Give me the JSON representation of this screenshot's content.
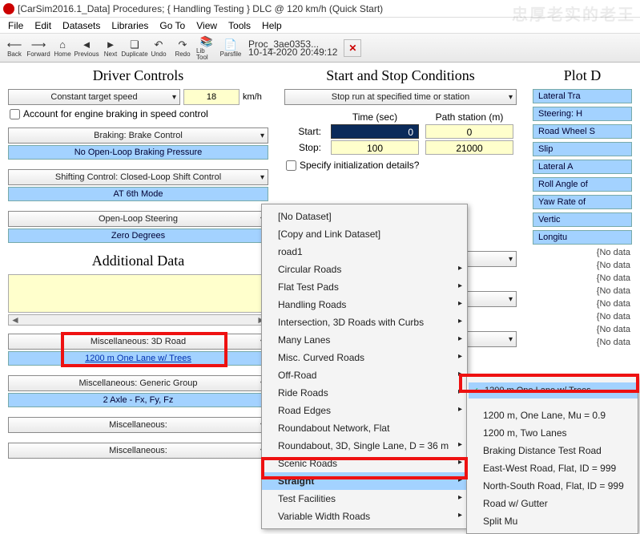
{
  "window": {
    "title": "[CarSim2016.1_Data] Procedures; { Handling Testing } DLC @ 120 km/h (Quick Start)"
  },
  "menu": [
    "File",
    "Edit",
    "Datasets",
    "Libraries",
    "Go To",
    "View",
    "Tools",
    "Help"
  ],
  "toolbar": {
    "back": "Back",
    "forward": "Forward",
    "home": "Home",
    "previous": "Previous",
    "next": "Next",
    "duplicate": "Duplicate",
    "undo": "Undo",
    "redo": "Redo",
    "libtool": "Lib Tool",
    "parsfile": "Parsfile",
    "proc_name": "Proc_3ae0353...",
    "proc_date": "10-14-2020 20:49:12",
    "delete": "Delete"
  },
  "driver": {
    "heading": "Driver Controls",
    "mode": "Constant target speed",
    "speed": "18",
    "unit": "km/h",
    "engine_braking": "Account for engine braking in speed control",
    "braking_label": "Braking: Brake Control",
    "braking_value": "No Open-Loop Braking Pressure",
    "shift_label": "Shifting Control: Closed-Loop Shift Control",
    "shift_value": "AT 6th Mode",
    "steer_label": "Open-Loop Steering",
    "steer_value": "Zero Degrees"
  },
  "additional": {
    "heading": "Additional Data",
    "misc_road_label": "Miscellaneous: 3D Road",
    "misc_road_value": "1200 m One Lane w/ Trees",
    "misc_group_label": "Miscellaneous: Generic Group",
    "misc_group_value": "2 Axle - Fx, Fy, Fz",
    "misc_blank": "Miscellaneous:"
  },
  "startstop": {
    "heading": "Start and Stop Conditions",
    "mode": "Stop run at specified time or station",
    "time_hdr": "Time (sec)",
    "path_hdr": "Path station (m)",
    "start_lab": "Start:",
    "stop_lab": "Stop:",
    "start_time": "0",
    "start_path": "0",
    "stop_time": "100",
    "stop_path": "21000",
    "init_details": "Specify initialization details?"
  },
  "plot": {
    "heading": "Plot D",
    "rows": [
      "Lateral Tra",
      "Steering: H",
      "Road Wheel S",
      "Slip",
      "Lateral A",
      "Roll Angle of",
      "Yaw Rate of",
      "Vertic",
      "Longitu"
    ],
    "nodata": "{No data"
  },
  "ctx_menu": {
    "items": [
      {
        "label": "[No Dataset]",
        "sub": false
      },
      {
        "label": "[Copy and Link Dataset]",
        "sub": false
      },
      {
        "label": "road1",
        "sub": false
      },
      {
        "label": "Circular Roads",
        "sub": true
      },
      {
        "label": "Flat Test Pads",
        "sub": true
      },
      {
        "label": "Handling Roads",
        "sub": true
      },
      {
        "label": "Intersection, 3D Roads with Curbs",
        "sub": true
      },
      {
        "label": "Many Lanes",
        "sub": true
      },
      {
        "label": "Misc. Curved Roads",
        "sub": true
      },
      {
        "label": "Off-Road",
        "sub": true
      },
      {
        "label": "Ride Roads",
        "sub": true
      },
      {
        "label": "Road Edges",
        "sub": true
      },
      {
        "label": "Roundabout Network, Flat",
        "sub": false
      },
      {
        "label": "Roundabout, 3D, Single Lane, D = 36 m",
        "sub": true
      },
      {
        "label": "Scenic Roads",
        "sub": true
      },
      {
        "label": "Straight",
        "sub": true,
        "sel": true
      },
      {
        "label": "Test Facilities",
        "sub": true
      },
      {
        "label": "Variable Width Roads",
        "sub": true
      }
    ]
  },
  "sub_menu": {
    "items": [
      {
        "label": "1200 m One Lane w/ Trees",
        "chk": true,
        "sel": true
      },
      {
        "label": "1200 m, One Lane, Mu = 0.9"
      },
      {
        "label": "1200 m, Two Lanes"
      },
      {
        "label": "Braking Distance Test Road"
      },
      {
        "label": "East-West Road, Flat, ID = 999"
      },
      {
        "label": "North-South Road, Flat, ID = 999"
      },
      {
        "label": "Road w/ Gutter"
      },
      {
        "label": "Split Mu"
      }
    ]
  },
  "watermark": "忠厚老实的老王"
}
